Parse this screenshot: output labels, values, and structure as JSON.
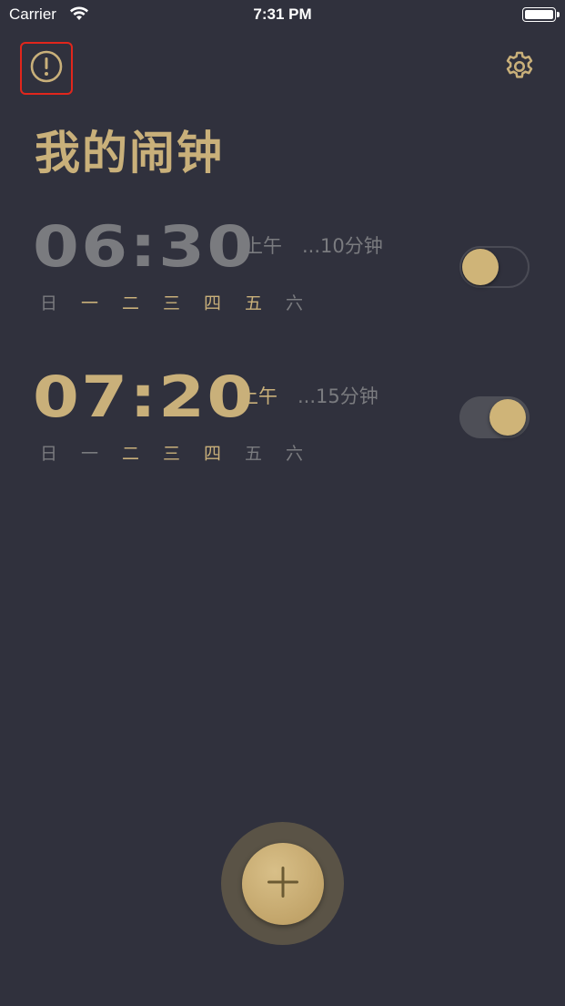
{
  "status_bar": {
    "carrier": "Carrier",
    "time": "7:31 PM",
    "wifi_icon": "wifi-icon",
    "battery_icon": "battery-icon"
  },
  "header": {
    "info_icon": "info-icon",
    "settings_icon": "gear-icon",
    "title": "我的闹钟"
  },
  "colors": {
    "background": "#30313d",
    "accent": "#c9b07a",
    "inactive": "#7a7b7f",
    "highlight_border": "#e1261c"
  },
  "alarms": [
    {
      "time": "06:30",
      "ampm": "上午",
      "snooze": "...10分钟",
      "enabled": false,
      "days": [
        {
          "label": "日",
          "active": false
        },
        {
          "label": "一",
          "active": true
        },
        {
          "label": "二",
          "active": true
        },
        {
          "label": "三",
          "active": true
        },
        {
          "label": "四",
          "active": true
        },
        {
          "label": "五",
          "active": true
        },
        {
          "label": "六",
          "active": false
        }
      ]
    },
    {
      "time": "07:20",
      "ampm": "上午",
      "snooze": "...15分钟",
      "enabled": true,
      "days": [
        {
          "label": "日",
          "active": false
        },
        {
          "label": "一",
          "active": false
        },
        {
          "label": "二",
          "active": true
        },
        {
          "label": "三",
          "active": true
        },
        {
          "label": "四",
          "active": true
        },
        {
          "label": "五",
          "active": false
        },
        {
          "label": "六",
          "active": false
        }
      ]
    }
  ],
  "add_button": {
    "icon": "plus-icon"
  }
}
